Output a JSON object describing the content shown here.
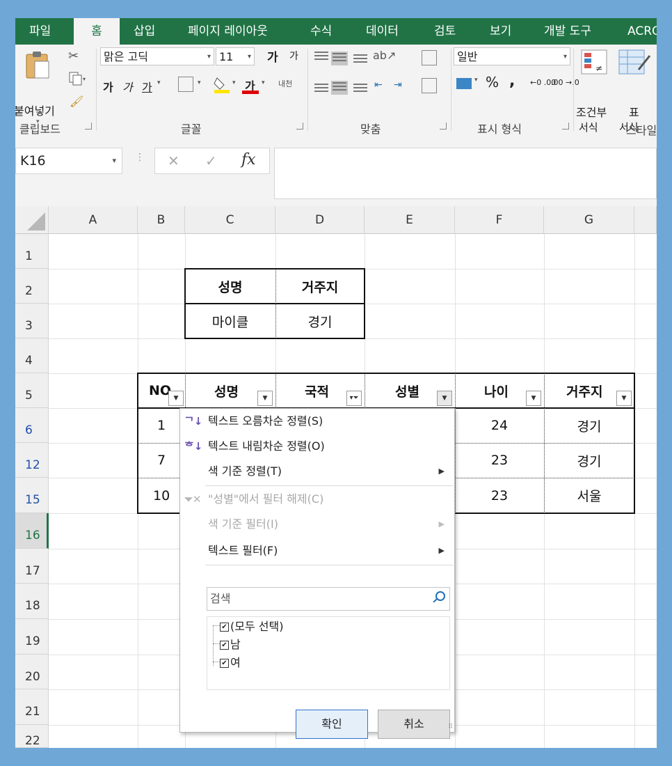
{
  "ribbon_tabs": [
    "파일",
    "홈",
    "삽입",
    "페이지 레이아웃",
    "수식",
    "데이터",
    "검토",
    "보기",
    "개발 도구",
    "ACRO"
  ],
  "active_tab": "홈",
  "accent_color": "#217346",
  "clipboard": {
    "paste_label": "붙여넣기",
    "group_label": "클립보드"
  },
  "font": {
    "name": "맑은 고딕",
    "size": "11",
    "grow": "가",
    "shrink": "가",
    "bold": "가",
    "italic": "가",
    "underline": "가",
    "font_color_label": "가",
    "phonetic": "내천",
    "group_label": "글꼴"
  },
  "alignment": {
    "group_label": "맞춤"
  },
  "number": {
    "format": "일반",
    "percent": "%",
    "comma": ",",
    "inc_decimal": "←0 .00",
    "dec_decimal": ".00 →.0",
    "group_label": "표시 형식"
  },
  "styles": {
    "conditional_line1": "조건부",
    "conditional_line2": "서식",
    "table_line1": "표",
    "table_line2": "서식",
    "group_label": "스타일"
  },
  "formula_bar": {
    "name_box": "K16",
    "cancel": "✕",
    "enter": "✓",
    "fx": "fx",
    "value": ""
  },
  "columns": [
    "A",
    "B",
    "C",
    "D",
    "E",
    "F",
    "G"
  ],
  "rows": [
    "1",
    "2",
    "3",
    "4",
    "5",
    "6",
    "12",
    "15",
    "16",
    "17",
    "18",
    "19",
    "20",
    "21",
    "22"
  ],
  "selected_row": "16",
  "small_table": {
    "headers": [
      "성명",
      "거주지"
    ],
    "values": [
      "마이클",
      "경기"
    ]
  },
  "main_table": {
    "headers": [
      "NO",
      "성명",
      "국적",
      "성별",
      "나이",
      "거주지"
    ],
    "rows": [
      [
        "1",
        "",
        "",
        "",
        "24",
        "경기"
      ],
      [
        "7",
        "",
        "",
        "",
        "23",
        "경기"
      ],
      [
        "10",
        "",
        "",
        "",
        "23",
        "서울"
      ]
    ],
    "filtered_column": "국적",
    "open_filter_column": "성별"
  },
  "filter_menu": {
    "sort_asc": "텍스트 오름차순 정렬(S)",
    "sort_desc": "텍스트 내림차순 정렬(O)",
    "sort_by_color": "색 기준 정렬(T)",
    "clear_filter": "\"성별\"에서 필터 해제(C)",
    "filter_by_color": "색 기준 필터(I)",
    "text_filter": "텍스트 필터(F)",
    "search_placeholder": "검색",
    "items": [
      {
        "label": "(모두 선택)",
        "checked": true
      },
      {
        "label": "남",
        "checked": true
      },
      {
        "label": "여",
        "checked": true
      }
    ],
    "ok": "확인",
    "cancel": "취소"
  }
}
